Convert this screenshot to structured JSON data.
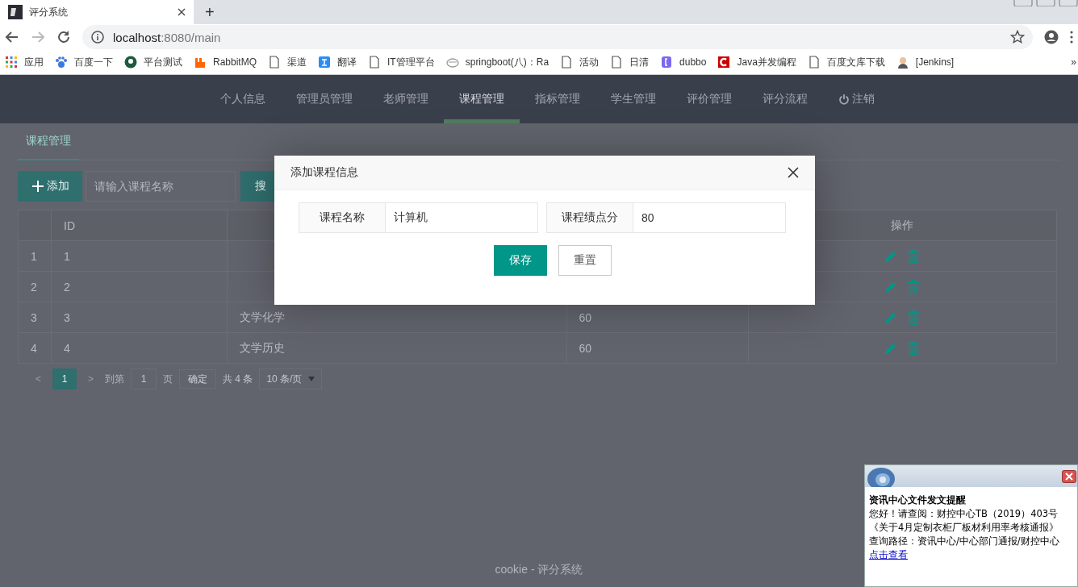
{
  "browser": {
    "tab": {
      "title": "评分系统"
    },
    "new_tab": "+",
    "address": {
      "host": "localhost",
      "path": ":8080/main"
    },
    "bookmarks": [
      {
        "label": "应用"
      },
      {
        "label": "百度一下"
      },
      {
        "label": "平台测试"
      },
      {
        "label": "RabbitMQ"
      },
      {
        "label": "渠道"
      },
      {
        "label": "翻译"
      },
      {
        "label": "IT管理平台"
      },
      {
        "label": "springboot(八)：Ra"
      },
      {
        "label": "活动"
      },
      {
        "label": "日清"
      },
      {
        "label": "dubbo"
      },
      {
        "label": "Java并发编程"
      },
      {
        "label": "百度文库下载"
      },
      {
        "label": "[Jenkins]"
      }
    ],
    "bookmarks_more": "»"
  },
  "nav": {
    "items": [
      {
        "label": "个人信息",
        "selected": false
      },
      {
        "label": "管理员管理",
        "selected": false
      },
      {
        "label": "老师管理",
        "selected": false
      },
      {
        "label": "课程管理",
        "selected": true
      },
      {
        "label": "指标管理",
        "selected": false
      },
      {
        "label": "学生管理",
        "selected": false
      },
      {
        "label": "评价管理",
        "selected": false
      },
      {
        "label": "评分流程",
        "selected": false
      },
      {
        "label": "注销",
        "selected": false,
        "kind": "logout"
      }
    ]
  },
  "subtabs": [
    {
      "label": "课程管理",
      "selected": true
    }
  ],
  "toolbar": {
    "add_button": "添加",
    "search": {
      "placeholder": "请输入课程名称"
    },
    "search_button": "搜"
  },
  "table": {
    "columns": [
      "ID",
      "操作"
    ],
    "rows": [
      {
        "index": "1",
        "id": "1"
      },
      {
        "index": "2",
        "id": "2"
      },
      {
        "index": "3",
        "id": "3",
        "name": "文学化学",
        "points": "60"
      },
      {
        "index": "4",
        "id": "4",
        "name": "文学历史",
        "points": "60"
      }
    ]
  },
  "pagination": {
    "prev": "<",
    "pages": [
      {
        "label": "1",
        "selected": true
      }
    ],
    "next": ">",
    "goto_label": "到第",
    "goto_value": "1",
    "page_unit": "页",
    "confirm": "确定",
    "total": "共 4 条",
    "page_size": "10 条/页"
  },
  "footer": "cookie - 评分系统",
  "dialog": {
    "title": "添加课程信息",
    "fields": [
      {
        "label": "课程名称",
        "value": "计算机"
      },
      {
        "label": "课程绩点分",
        "value": "80"
      }
    ],
    "buttons": [
      {
        "label": "保存",
        "kind": "primary"
      },
      {
        "label": "重置",
        "kind": "plain"
      }
    ]
  },
  "notice": {
    "title": "资讯中心文件发文提醒",
    "lines": [
      "您好！请查阅：财控中心TB（2019）403号",
      "《关于4月定制衣柜厂板材利用率考核通报》",
      "查询路径：资讯中心/中心部门通报/财控中心"
    ],
    "link": "点击查看"
  }
}
